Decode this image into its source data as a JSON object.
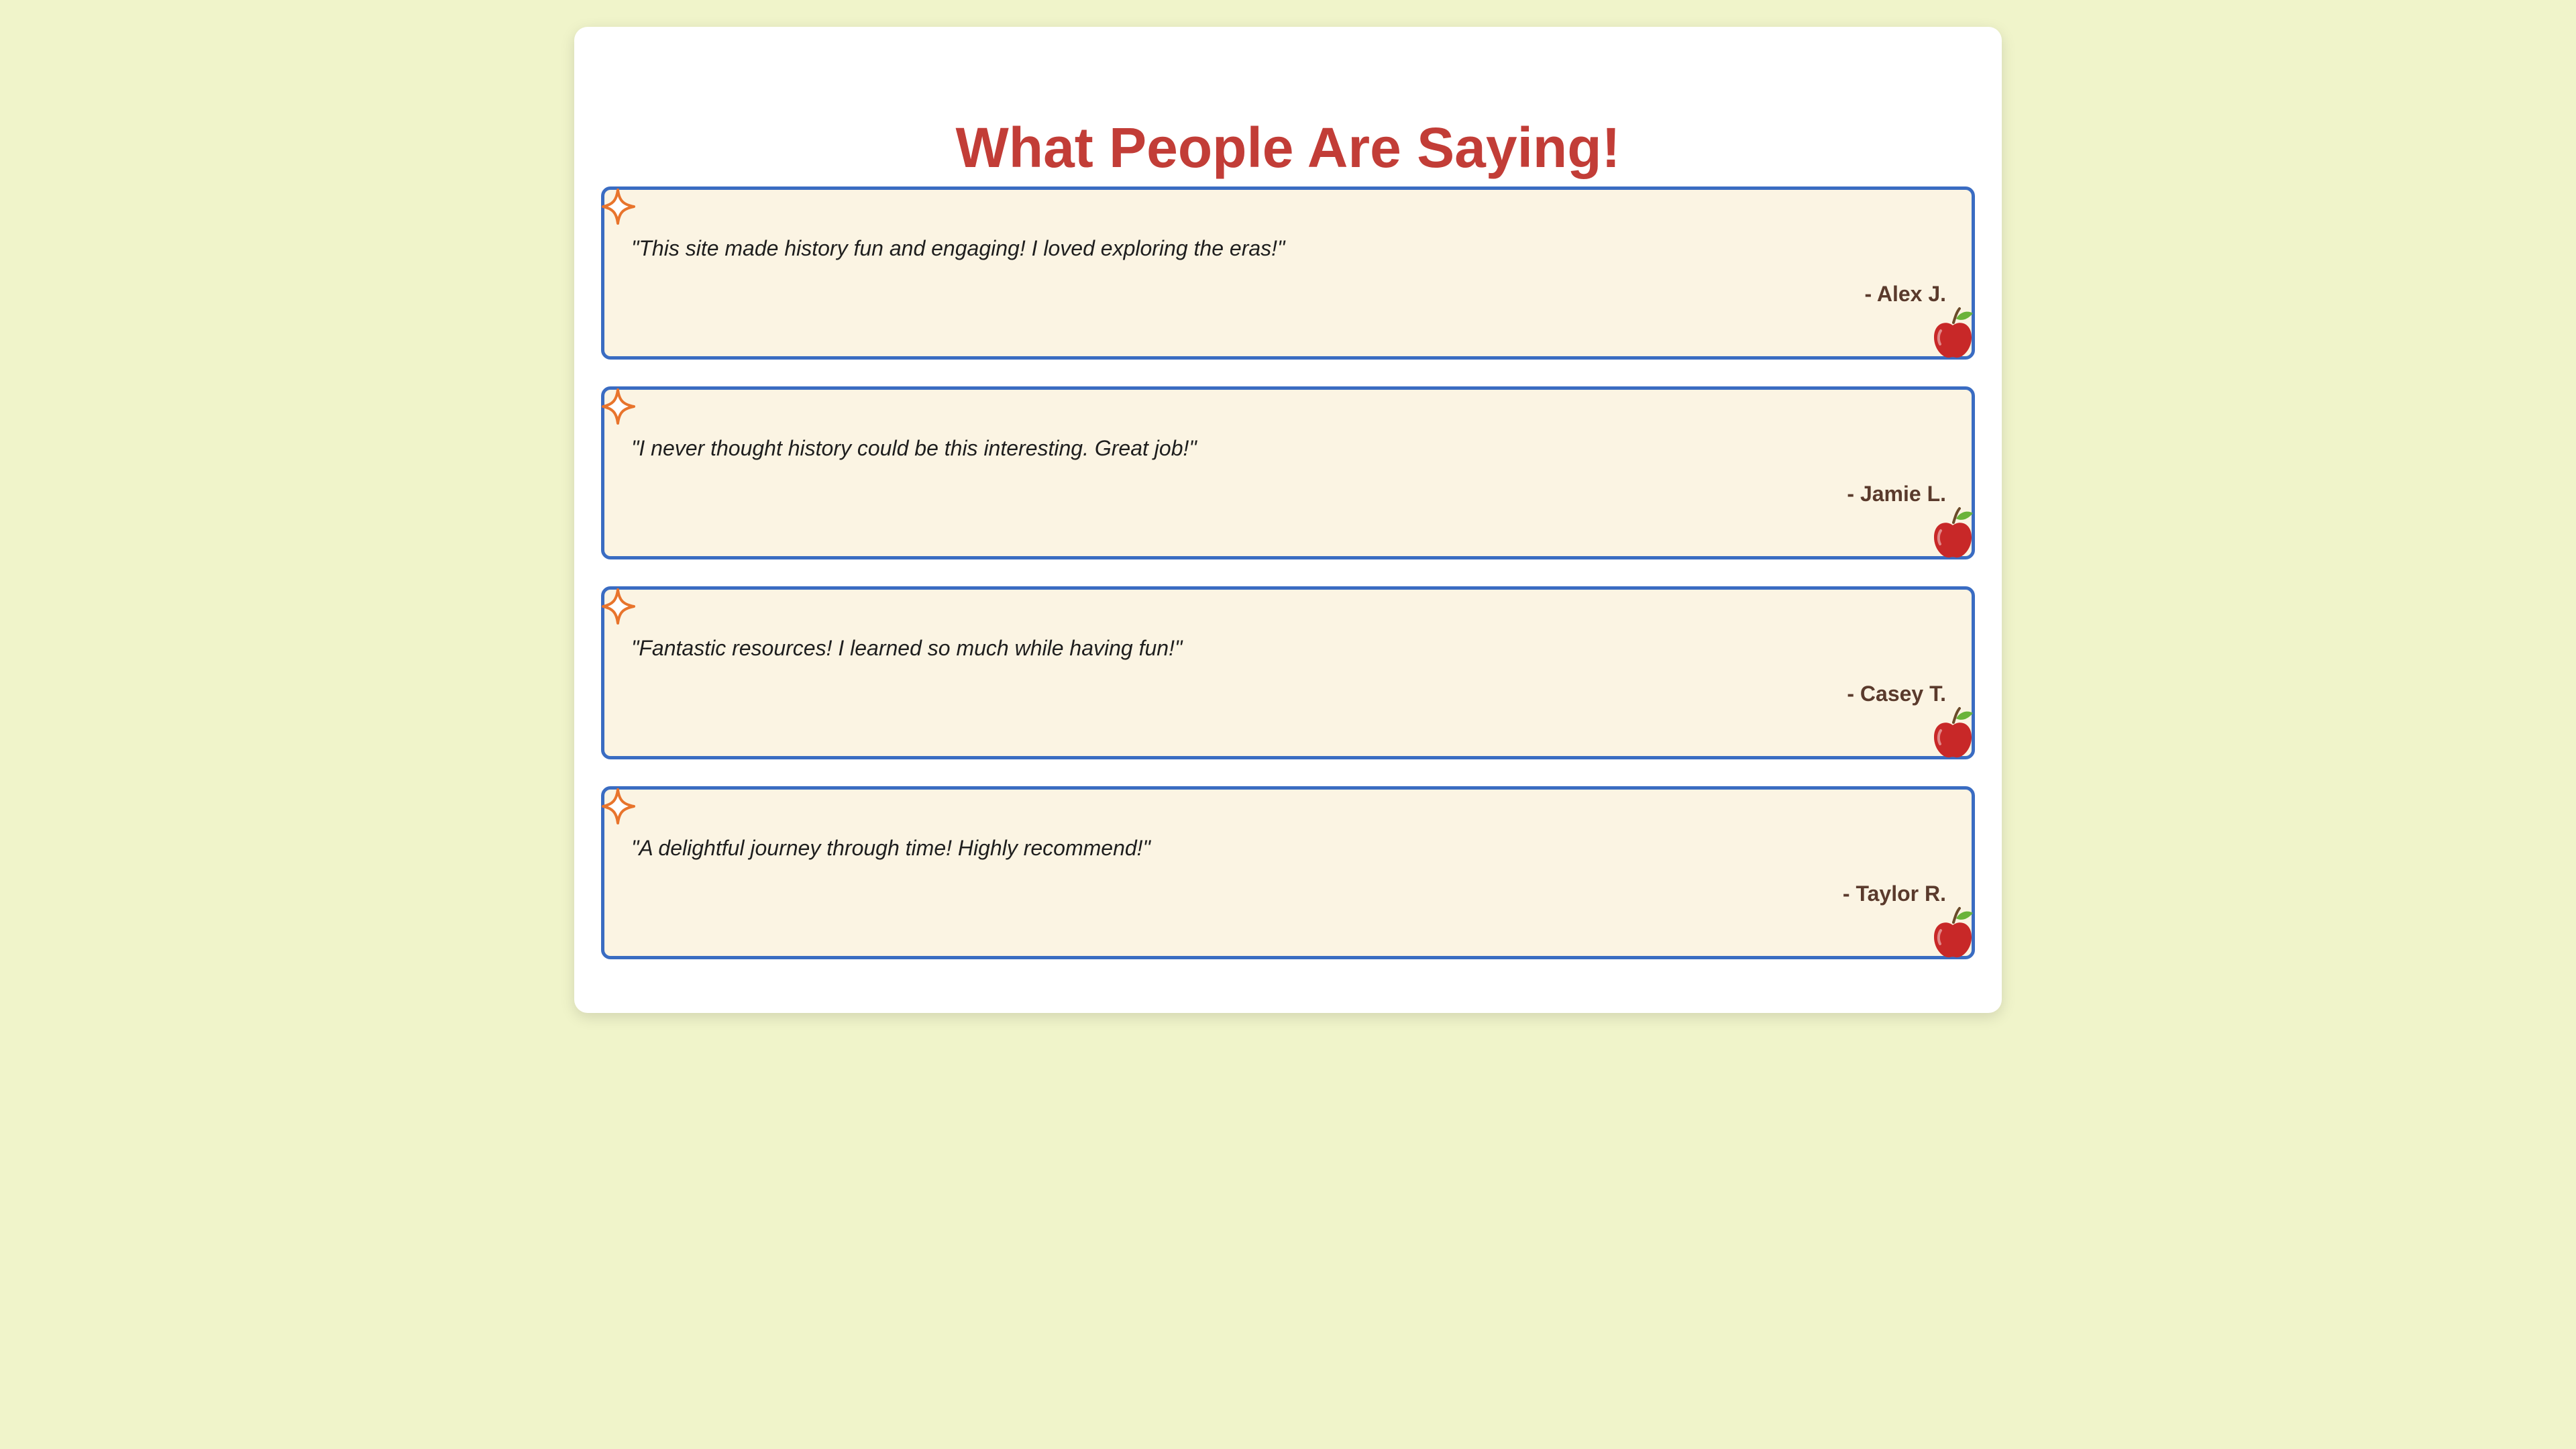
{
  "page": {
    "title": "What People Are Saying!"
  },
  "icons": {
    "corner_top_left": "sparkle-icon",
    "corner_bottom_right": "apple-icon"
  },
  "colors": {
    "background": "#f0f4ca",
    "panel": "#ffffff",
    "title": "#c23d37",
    "card_background": "#fbf4e3",
    "card_border": "#3a6cc2",
    "author": "#5a3a2c",
    "sparkle": "#e8742c",
    "apple": "#c82828"
  },
  "testimonials": [
    {
      "quote": "\"This site made history fun and engaging! I loved exploring the eras!\"",
      "author": "- Alex J."
    },
    {
      "quote": "\"I never thought history could be this interesting. Great job!\"",
      "author": "- Jamie L."
    },
    {
      "quote": "\"Fantastic resources! I learned so much while having fun!\"",
      "author": "- Casey T."
    },
    {
      "quote": "\"A delightful journey through time! Highly recommend!\"",
      "author": "- Taylor R."
    }
  ]
}
